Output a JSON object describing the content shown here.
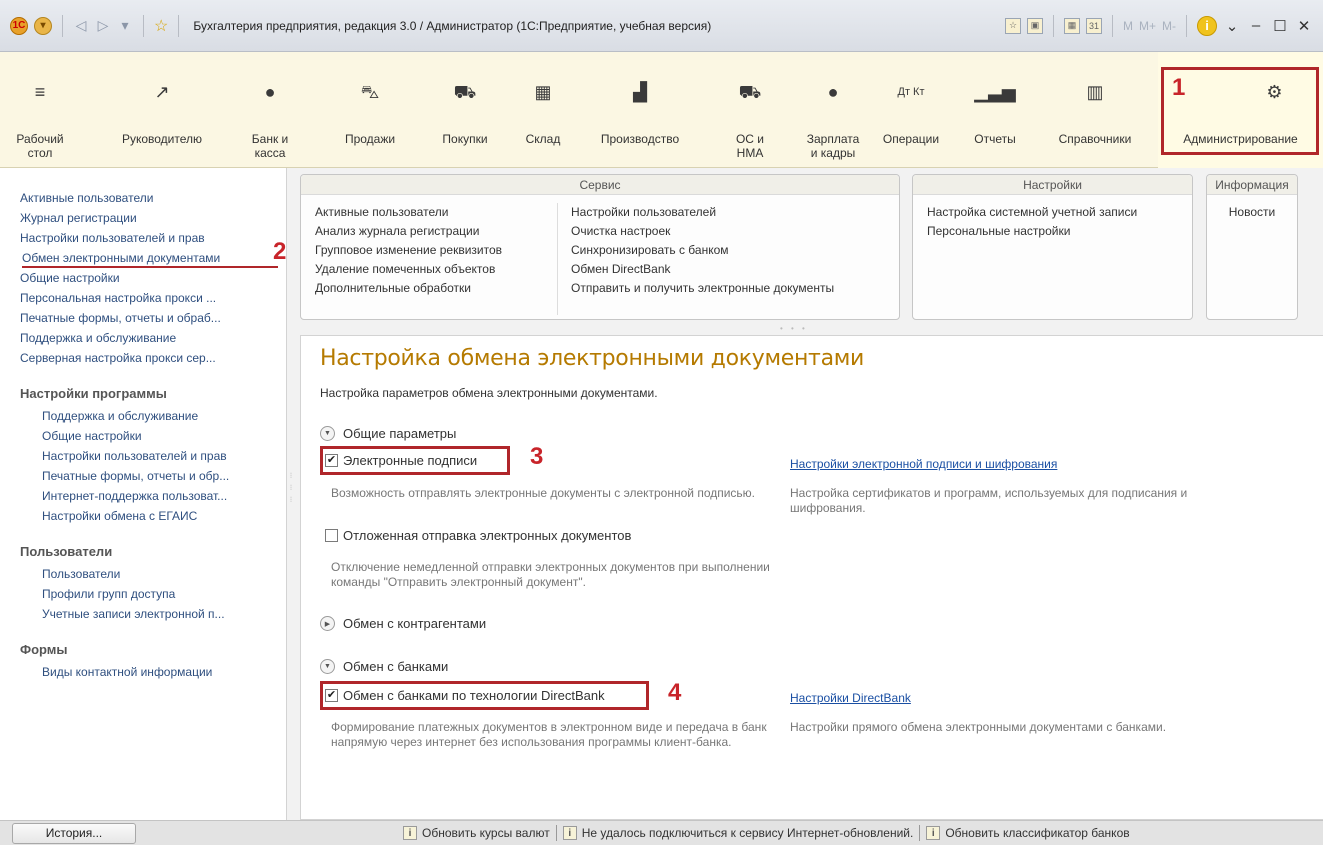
{
  "window": {
    "title": "Бухгалтерия предприятия, редакция 3.0 / Администратор  (1С:Предприятие, учебная версия)",
    "m_buttons": [
      "M",
      "M+",
      "M-"
    ]
  },
  "sections": [
    {
      "label": "Рабочий\nстол",
      "icon": "menu-lines-icon"
    },
    {
      "label": "Руководителю",
      "icon": "trend-chart-icon"
    },
    {
      "label": "Банк и\nкасса",
      "icon": "ruble-coin-icon"
    },
    {
      "label": "Продажи",
      "icon": "shopping-bag-icon"
    },
    {
      "label": "Покупки",
      "icon": "cart-icon"
    },
    {
      "label": "Склад",
      "icon": "warehouse-grid-icon"
    },
    {
      "label": "Производство",
      "icon": "factory-icon"
    },
    {
      "label": "ОС и\nНМА",
      "icon": "truck-icon"
    },
    {
      "label": "Зарплата\nи кадры",
      "icon": "person-icon"
    },
    {
      "label": "Операции",
      "icon": "dt-kt-icon"
    },
    {
      "label": "Отчеты",
      "icon": "bar-chart-icon"
    },
    {
      "label": "Справочники",
      "icon": "books-icon"
    },
    {
      "label": "Администрирование",
      "icon": "gear-icon"
    }
  ],
  "annotations": {
    "n1": "1",
    "n2": "2",
    "n3": "3",
    "n4": "4"
  },
  "leftnav": {
    "top_items": [
      "Активные пользователи",
      "Журнал регистрации",
      "Настройки пользователей и прав",
      "Обмен электронными документами",
      "Общие настройки",
      "Персональная настройка прокси ...",
      "Печатные формы, отчеты и обраб...",
      "Поддержка и обслуживание",
      "Серверная настройка прокси сер..."
    ],
    "groups": [
      {
        "title": "Настройки программы",
        "items": [
          "Поддержка и обслуживание",
          "Общие настройки",
          "Настройки пользователей и прав",
          "Печатные формы, отчеты и обр...",
          "Интернет-поддержка пользоват...",
          "Настройки обмена с ЕГАИС"
        ]
      },
      {
        "title": "Пользователи",
        "items": [
          "Пользователи",
          "Профили групп доступа",
          "Учетные записи электронной п..."
        ]
      },
      {
        "title": "Формы",
        "items": [
          "Виды контактной информации"
        ]
      }
    ]
  },
  "command_panel": {
    "service": {
      "header": "Сервис",
      "col1": [
        "Активные пользователи",
        "Анализ журнала регистрации",
        "Групповое изменение реквизитов",
        "Удаление помеченных объектов",
        "Дополнительные обработки"
      ],
      "col2": [
        "Настройки пользователей",
        "Очистка настроек",
        "Синхронизировать с банком",
        "Обмен DirectBank",
        "Отправить и получить электронные документы"
      ]
    },
    "settings": {
      "header": "Настройки",
      "items": [
        "Настройка системной учетной записи",
        "Персональные настройки"
      ]
    },
    "info": {
      "header": "Информация",
      "items": [
        "Новости"
      ]
    }
  },
  "main": {
    "title": "Настройка обмена электронными документами",
    "description": "Настройка параметров обмена электронными документами.",
    "general_group": "Общие параметры",
    "signatures_checkbox": "Электронные подписи",
    "signatures_checked": true,
    "signatures_hint": "Возможность отправлять электронные документы с электронной подписью.",
    "signatures_link": "Настройки электронной подписи и шифрования",
    "signatures_link_hint": "Настройка сертификатов и программ, используемых для подписания и шифрования.",
    "deferred_checkbox": "Отложенная отправка электронных документов",
    "deferred_checked": false,
    "deferred_hint": "Отключение немедленной отправки электронных документов при выполнении команды \"Отправить электронный документ\".",
    "counterparties_group": "Обмен с контрагентами",
    "banks_group": "Обмен с банками",
    "directbank_checkbox": "Обмен с банками по технологии DirectBank",
    "directbank_checked": true,
    "directbank_hint": "Формирование платежных документов в электронном виде и передача в банк напрямую через интернет без использования программы клиент-банка.",
    "directbank_link": "Настройки DirectBank",
    "directbank_link_hint": "Настройки прямого обмена электронными документами с банками."
  },
  "statusbar": {
    "history_button": "История...",
    "notes": [
      "Обновить курсы валют",
      "Не удалось подключиться к сервису Интернет-обновлений.",
      "Обновить классификатор банков"
    ]
  }
}
